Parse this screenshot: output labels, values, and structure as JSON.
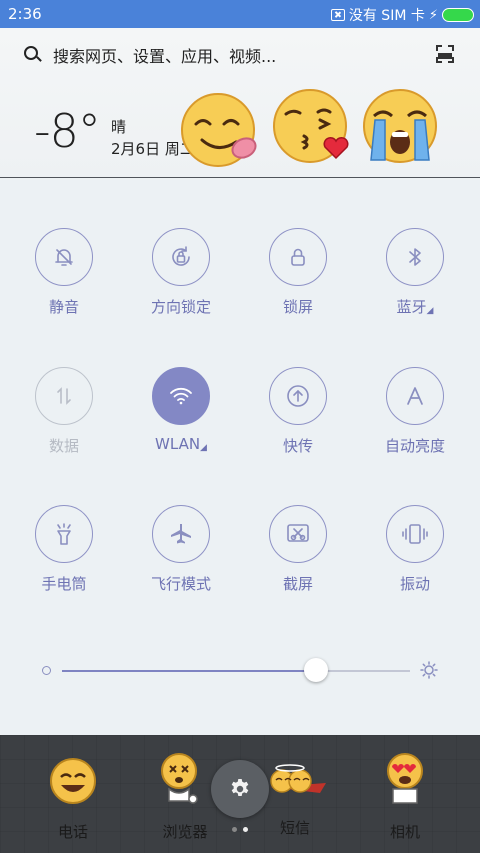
{
  "status_bar": {
    "time": "2:36",
    "sim_text": "没有 SIM 卡",
    "battery_color": "#35d84b",
    "icons": [
      "sim-icon",
      "charging-bolt-icon",
      "battery-icon"
    ]
  },
  "header": {
    "search_placeholder": "搜索网页、设置、应用、视频...",
    "temperature": "-8°",
    "weather": "晴",
    "date": "2月6日 周二",
    "emojis": [
      "tongue-out-emoji",
      "kiss-heart-emoji",
      "crying-emoji"
    ]
  },
  "quick_settings": {
    "accent_color": "#8388c5",
    "tiles": [
      {
        "label": "静音",
        "icon": "bell-mute-icon",
        "state": "off"
      },
      {
        "label": "方向锁定",
        "icon": "rotation-lock-icon",
        "state": "off"
      },
      {
        "label": "锁屏",
        "icon": "lock-icon",
        "state": "off"
      },
      {
        "label": "蓝牙",
        "icon": "bluetooth-icon",
        "state": "off",
        "has_submenu": true
      },
      {
        "label": "数据",
        "icon": "mobile-data-icon",
        "state": "disabled"
      },
      {
        "label": "WLAN",
        "icon": "wifi-icon",
        "state": "on",
        "has_submenu": true
      },
      {
        "label": "快传",
        "icon": "quick-transfer-icon",
        "state": "off"
      },
      {
        "label": "自动亮度",
        "icon": "auto-brightness-icon",
        "state": "off"
      },
      {
        "label": "手电筒",
        "icon": "flashlight-icon",
        "state": "off"
      },
      {
        "label": "飞行模式",
        "icon": "airplane-icon",
        "state": "off"
      },
      {
        "label": "截屏",
        "icon": "screenshot-icon",
        "state": "off"
      },
      {
        "label": "振动",
        "icon": "vibrate-icon",
        "state": "off"
      }
    ],
    "brightness_level": 0.73
  },
  "dock": {
    "items": [
      {
        "label": "电话",
        "icon": "phone-app-icon"
      },
      {
        "label": "浏览器",
        "icon": "browser-app-icon"
      },
      {
        "label": "短信",
        "icon": "messages-app-icon"
      },
      {
        "label": "相机",
        "icon": "camera-app-icon"
      }
    ],
    "settings_icon": "gear-icon",
    "page_count": 2,
    "current_page": 2
  }
}
